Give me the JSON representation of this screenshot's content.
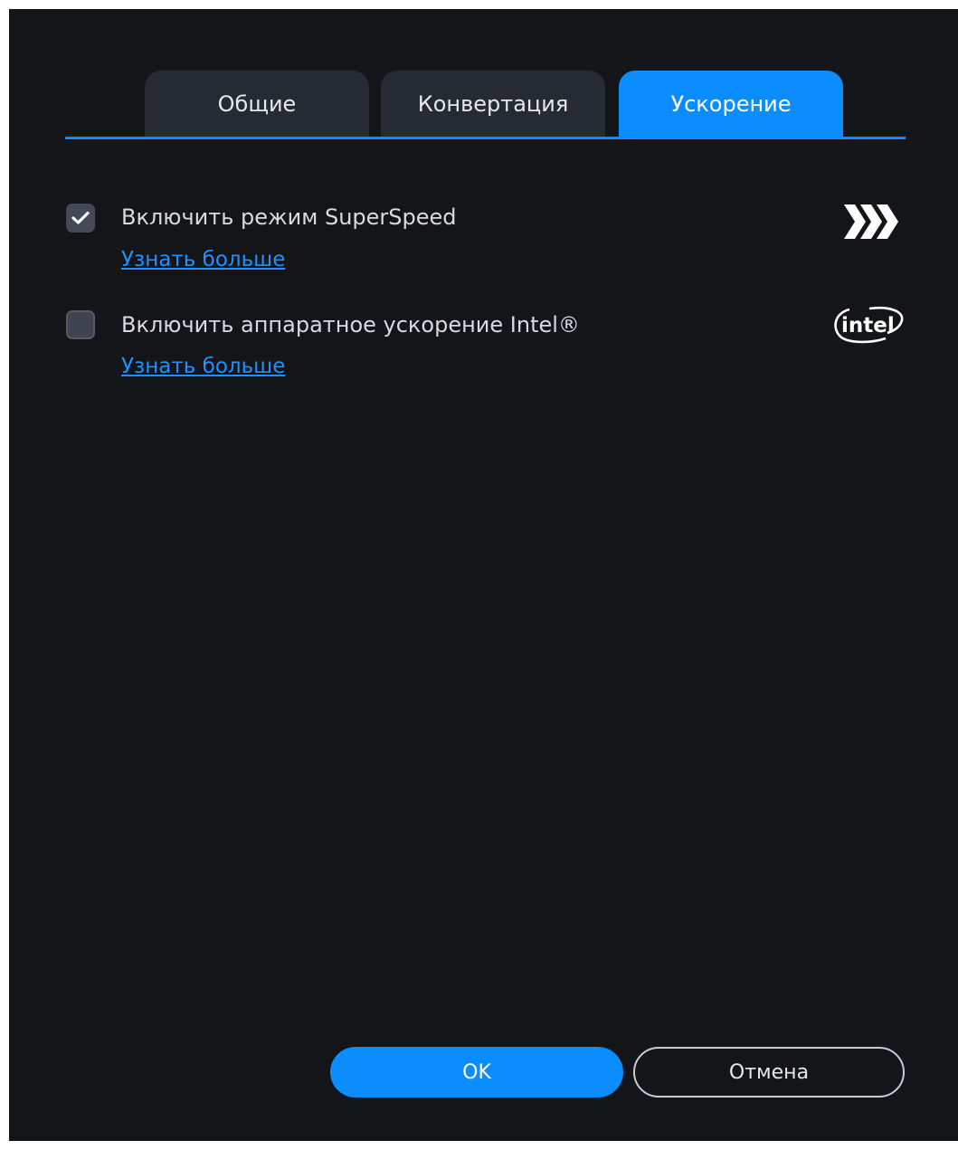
{
  "tabs": [
    {
      "label": "Общие",
      "active": false
    },
    {
      "label": "Конвертация",
      "active": false
    },
    {
      "label": "Ускорение",
      "active": true
    }
  ],
  "options": {
    "superspeed": {
      "label": "Включить режим SuperSpeed",
      "checked": true,
      "link": "Узнать больше",
      "icon": "superspeed-chevrons-icon"
    },
    "intel": {
      "label": "Включить аппаратное ускорение Intel®",
      "checked": false,
      "link": "Узнать больше",
      "icon": "intel-logo-icon",
      "logo_text": "intel"
    }
  },
  "buttons": {
    "ok": "OK",
    "cancel": "Отмена"
  },
  "colors": {
    "background": "#141519",
    "accent": "#0b8cff",
    "tab_inactive": "#262a33",
    "link": "#1e90ff"
  }
}
